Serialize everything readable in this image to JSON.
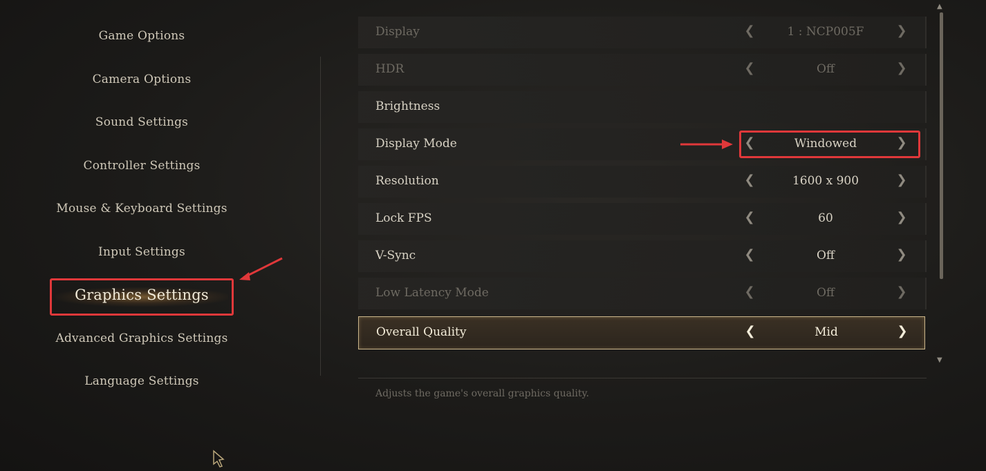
{
  "menu": {
    "items": [
      {
        "label": "Game Options"
      },
      {
        "label": "Camera Options"
      },
      {
        "label": "Sound Settings"
      },
      {
        "label": "Controller Settings"
      },
      {
        "label": "Mouse & Keyboard Settings"
      },
      {
        "label": "Input Settings"
      },
      {
        "label": "Graphics Settings"
      },
      {
        "label": "Advanced Graphics Settings"
      },
      {
        "label": "Language Settings"
      }
    ],
    "active": "Graphics Settings"
  },
  "settings": [
    {
      "label": "Display",
      "value": "1 : NCP005F"
    },
    {
      "label": "HDR",
      "value": "Off"
    },
    {
      "label": "Brightness",
      "value": ""
    },
    {
      "label": "Display Mode",
      "value": "Windowed"
    },
    {
      "label": "Resolution",
      "value": "1600 x 900"
    },
    {
      "label": "Lock FPS",
      "value": "60"
    },
    {
      "label": "V-Sync",
      "value": "Off"
    },
    {
      "label": "Low Latency Mode",
      "value": "Off"
    },
    {
      "label": "Overall Quality",
      "value": "Mid"
    }
  ],
  "description": "Adjusts the game's overall graphics quality.",
  "icons": {
    "left_arrow": "chevron-left-icon",
    "right_arrow": "chevron-right-icon",
    "cursor": "mouse-cursor-icon"
  },
  "colors": {
    "annotation": "#e0383a",
    "selected_border": "#c9b48a",
    "background": "#1c1b19"
  }
}
